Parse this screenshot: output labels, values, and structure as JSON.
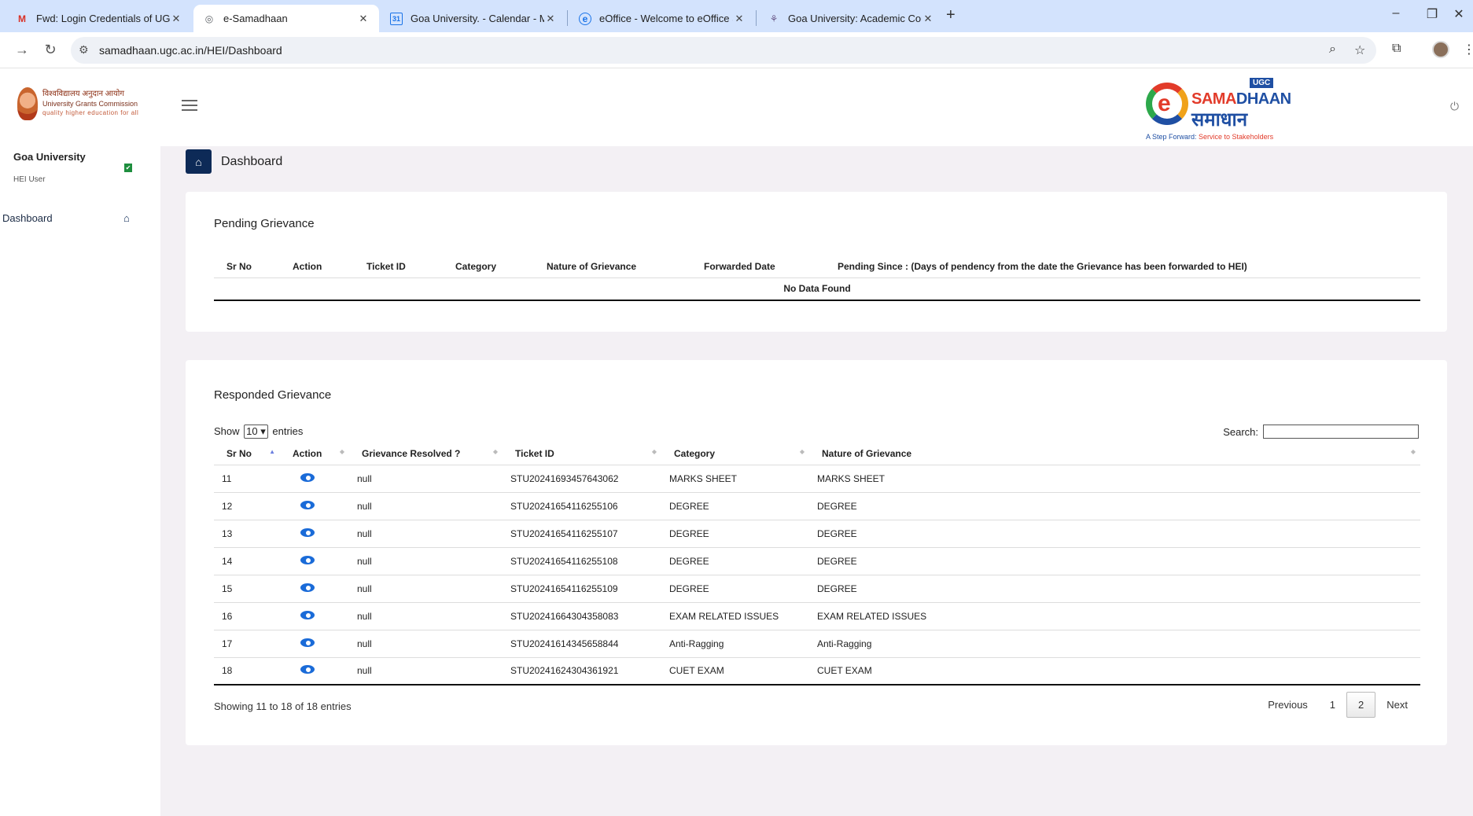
{
  "browser": {
    "tabs": [
      {
        "title": "Fwd: Login Credentials of UGC",
        "icon": "gmail-icon",
        "icon_glyph": "M",
        "icon_color": "#d93025",
        "active": false
      },
      {
        "title": "e-Samadhaan",
        "icon": "globe-icon",
        "icon_glyph": "◎",
        "icon_color": "#5f6368",
        "active": true
      },
      {
        "title": "Goa University. - Calendar - Ma",
        "icon": "calendar-icon",
        "icon_glyph": "31",
        "icon_color": "#1a73e8",
        "active": false
      },
      {
        "title": "eOffice - Welcome to eOffice Su",
        "icon": "eoffice-icon",
        "icon_glyph": "e",
        "icon_color": "#1a73e8",
        "active": false
      },
      {
        "title": "Goa University: Academic Coun",
        "icon": "goa-university-icon",
        "icon_glyph": "⚘",
        "icon_color": "#6b5a8a",
        "active": false
      }
    ],
    "url": "samadhaan.ugc.ac.in/HEI/Dashboard"
  },
  "header": {
    "ugc_hindi": "विश्वविद्यालय अनुदान आयोग",
    "ugc_name": "University Grants Commission",
    "ugc_tagline": "quality higher education for all",
    "samadhaan_badge": "UGC",
    "samadhaan_title_a": "SAMA",
    "samadhaan_title_b": "DHAAN",
    "samadhaan_hindi": "समाधान",
    "samadhaan_tag_a": "A Step Forward: ",
    "samadhaan_tag_b": "Service to Stakeholders"
  },
  "sidebar": {
    "university": "Goa University",
    "role": "HEI User",
    "items": [
      {
        "label": "Dashboard"
      }
    ]
  },
  "breadcrumb": {
    "title": "Dashboard"
  },
  "pending": {
    "title": "Pending Grievance",
    "columns": [
      "Sr No",
      "Action",
      "Ticket ID",
      "Category",
      "Nature of Grievance",
      "Forwarded Date",
      "Pending Since : (Days of pendency from the date the Grievance has been forwarded to HEI)"
    ],
    "empty": "No Data Found"
  },
  "responded": {
    "title": "Responded Grievance",
    "show_label": "Show",
    "entries_value": "10",
    "entries_label": "entries",
    "search_label": "Search:",
    "columns": [
      "Sr No",
      "Action",
      "Grievance Resolved ?",
      "Ticket ID",
      "Category",
      "Nature of Grievance"
    ],
    "rows": [
      {
        "sr": "11",
        "resolved": "null",
        "ticket": "STU20241693457643062",
        "category": "MARKS SHEET",
        "nature": "MARKS SHEET"
      },
      {
        "sr": "12",
        "resolved": "null",
        "ticket": "STU20241654116255106",
        "category": "DEGREE",
        "nature": "DEGREE"
      },
      {
        "sr": "13",
        "resolved": "null",
        "ticket": "STU20241654116255107",
        "category": "DEGREE",
        "nature": "DEGREE"
      },
      {
        "sr": "14",
        "resolved": "null",
        "ticket": "STU20241654116255108",
        "category": "DEGREE",
        "nature": "DEGREE"
      },
      {
        "sr": "15",
        "resolved": "null",
        "ticket": "STU20241654116255109",
        "category": "DEGREE",
        "nature": "DEGREE"
      },
      {
        "sr": "16",
        "resolved": "null",
        "ticket": "STU20241664304358083",
        "category": "EXAM RELATED ISSUES",
        "nature": "EXAM RELATED ISSUES"
      },
      {
        "sr": "17",
        "resolved": "null",
        "ticket": "STU20241614345658844",
        "category": "Anti-Ragging",
        "nature": "Anti-Ragging"
      },
      {
        "sr": "18",
        "resolved": "null",
        "ticket": "STU20241624304361921",
        "category": "CUET EXAM",
        "nature": "CUET EXAM"
      }
    ],
    "info": "Showing 11 to 18 of 18 entries",
    "pager": {
      "previous": "Previous",
      "pages": [
        "1",
        "2"
      ],
      "current": "2",
      "next": "Next"
    }
  },
  "colors": {
    "accent": "#0d2a57",
    "eye": "#1a6bd8",
    "tabbar": "#d3e3fd"
  }
}
